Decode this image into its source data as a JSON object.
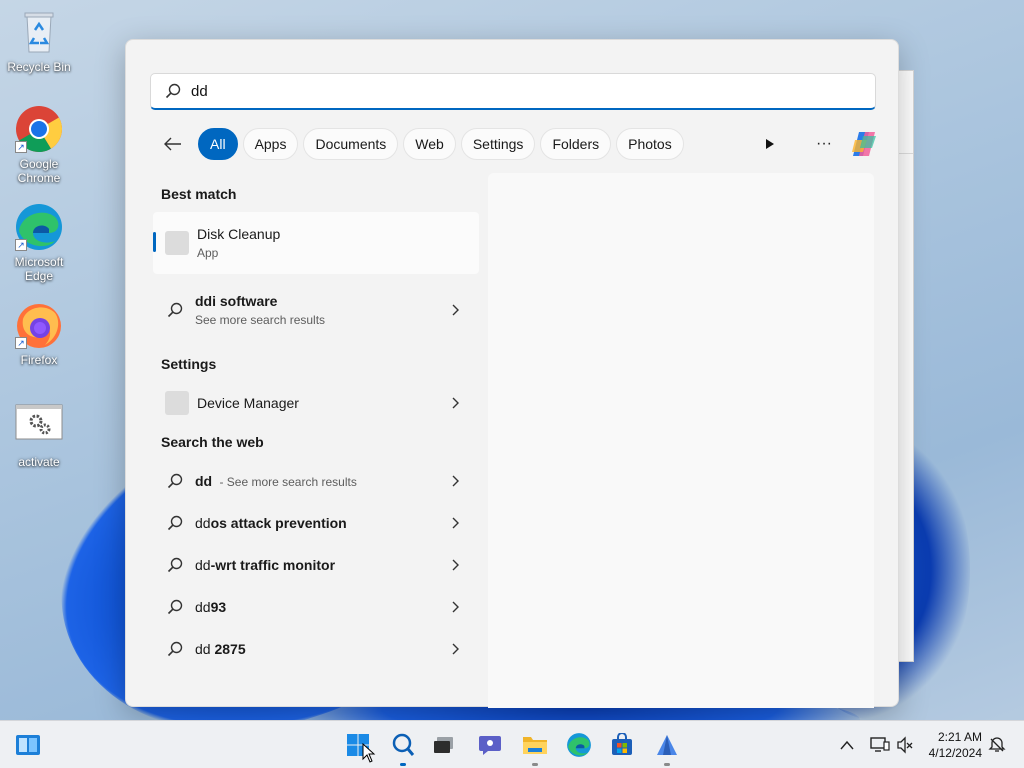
{
  "desktop": {
    "icons": [
      {
        "label": "Recycle Bin",
        "icon": "recycle-bin-icon"
      },
      {
        "label": "Google Chrome",
        "icon": "chrome-icon"
      },
      {
        "label": "Microsoft Edge",
        "icon": "edge-icon"
      },
      {
        "label": "Firefox",
        "icon": "firefox-icon"
      },
      {
        "label": "activate",
        "icon": "settings-file-icon"
      }
    ]
  },
  "search": {
    "query": "dd",
    "filters": [
      "All",
      "Apps",
      "Documents",
      "Web",
      "Settings",
      "Folders",
      "Photos"
    ],
    "active_filter": "All"
  },
  "results": {
    "best_match_title": "Best match",
    "best_match": {
      "name": "Disk Cleanup",
      "type": "App"
    },
    "more_results": {
      "bold": "dd",
      "rest": "i software",
      "sub": "See more search results"
    },
    "settings_title": "Settings",
    "settings_item": "Device Manager",
    "web_title": "Search the web",
    "web_items": [
      {
        "bold": "dd",
        "rest": "",
        "extra": " - See more search results"
      },
      {
        "bold": "dd",
        "rest": "os attack prevention",
        "extra": ""
      },
      {
        "bold": "dd",
        "rest": "-wrt traffic monitor",
        "extra": ""
      },
      {
        "bold": "dd",
        "rest": "93",
        "extra": ""
      },
      {
        "bold": "dd",
        "rest": " 2875",
        "extra": ""
      }
    ]
  },
  "taskbar": {
    "apps": [
      "widgets-icon",
      "start-icon",
      "search-icon",
      "task-view-icon",
      "teams-chat-icon",
      "file-explorer-icon",
      "edge-icon",
      "store-icon",
      "app-icon"
    ],
    "time": "2:21 AM",
    "date": "4/12/2024"
  },
  "colors": {
    "accent": "#0067c0"
  }
}
